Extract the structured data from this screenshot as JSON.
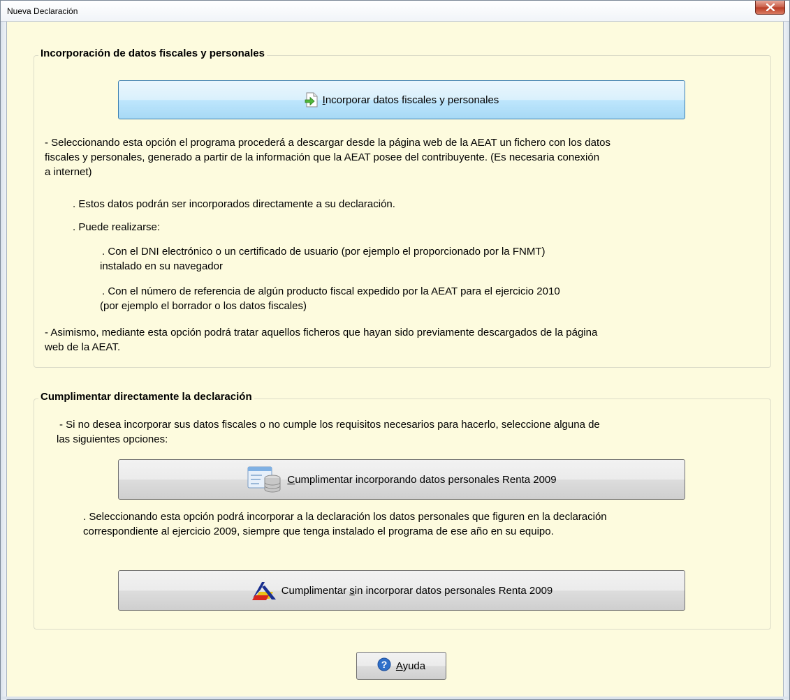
{
  "window": {
    "title": "Nueva Declaración",
    "close_icon": "close-icon"
  },
  "section_incorporacion": {
    "legend": "Incorporación de datos fiscales y personales",
    "button": {
      "hotkey": "I",
      "label_rest": "ncorporar datos fiscales y personales",
      "icon": "document-arrow-icon"
    },
    "paragraph_1_lines": [
      "- Seleccionando esta opción el programa procederá a descargar desde la página web de la AEAT un fichero con los datos",
      "fiscales y personales, generado a partir de la información que la AEAT posee del contribuyente. (Es necesaria conexión",
      "a internet)"
    ],
    "bullet_1": ". Estos datos podrán ser incorporados directamente a su declaración.",
    "bullet_2": ". Puede realizarse:",
    "sub_1_lines": [
      ". Con el DNI electrónico o un certificado de usuario (por ejemplo el proporcionado por la FNMT)",
      "instalado en su navegador"
    ],
    "sub_2_lines": [
      ". Con el número de referencia de algún producto fiscal expedido por la AEAT para el ejercicio 2010",
      "(por ejemplo el borrador o los datos fiscales)"
    ],
    "paragraph_2_lines": [
      "- Asimismo, mediante esta opción podrá tratar aquellos ficheros que hayan sido previamente descargados de la página",
      "web de la AEAT."
    ]
  },
  "section_cumplimentar": {
    "legend": "Cumplimentar directamente la declaración",
    "intro_lines": [
      "- Si no desea incorporar sus datos fiscales o no cumple los requisitos necesarios para hacerlo, seleccione alguna de",
      "las siguientes opciones:"
    ],
    "button_1": {
      "hotkey": "C",
      "label_rest": "umplimentar incorporando datos personales Renta 2009",
      "icon": "database-window-icon"
    },
    "button_1_desc_lines": [
      ". Seleccionando esta opción podrá incorporar a la declaración los datos personales que figuren en la declaración",
      "correspondiente al ejercicio 2009, siempre que tenga instalado el programa de ese año en su equipo."
    ],
    "button_2": {
      "label_before": "Cumplimentar ",
      "hotkey": "s",
      "label_after": "in incorporar datos personales Renta 2009",
      "icon": "aeat-logo-icon"
    }
  },
  "help_button": {
    "hotkey": "A",
    "label_rest": "yuda",
    "icon": "help-icon"
  },
  "colors": {
    "background": "#fdfbde",
    "primary_button": "#bee6fd",
    "help_icon": "#2f6fc9"
  }
}
